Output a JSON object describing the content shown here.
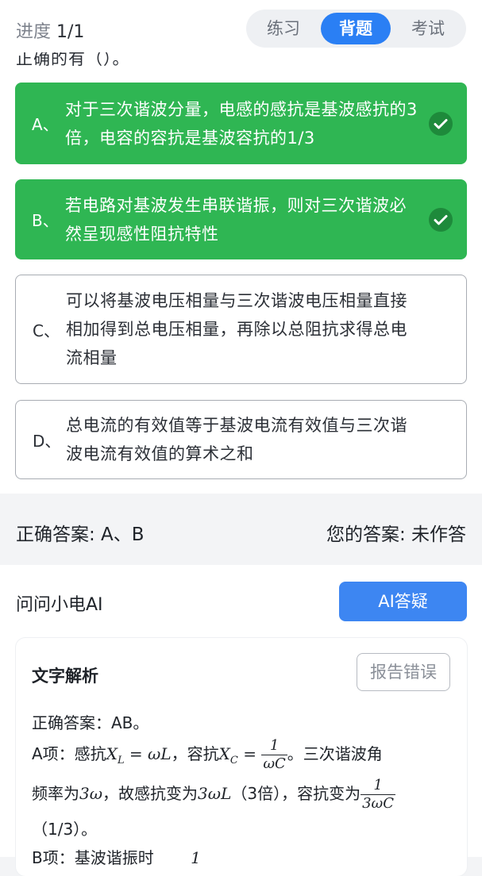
{
  "header": {
    "progress_label": "进度",
    "progress_value": "1/1",
    "tabs": [
      {
        "label": "练习",
        "active": false
      },
      {
        "label": "背题",
        "active": true
      },
      {
        "label": "考试",
        "active": false
      }
    ]
  },
  "question": {
    "partial_stem": "正确的有（）。",
    "options": [
      {
        "letter": "A、",
        "text": "对于三次谐波分量，电感的感抗是基波感抗的3倍，电容的容抗是基波容抗的1/3",
        "correct": true
      },
      {
        "letter": "B、",
        "text": "若电路对基波发生串联谐振，则对三次谐波必然呈现感性阻抗特性",
        "correct": true
      },
      {
        "letter": "C、",
        "text": "可以将基波电压相量与三次谐波电压相量直接相加得到总电压相量，再除以总阻抗求得总电流相量",
        "correct": false
      },
      {
        "letter": "D、",
        "text": "总电流的有效值等于基波电流有效值与三次谐波电流有效值的算术之和",
        "correct": false
      }
    ]
  },
  "answers": {
    "correct": "正确答案: A、B",
    "yours": "您的答案: 未作答"
  },
  "ai": {
    "label": "问问小电AI",
    "button": "AI答疑"
  },
  "analysis": {
    "title": "文字解析",
    "report_button": "报告错误",
    "line1": "正确答案：AB。",
    "a_prefix": "A项：感抗",
    "xl": "X",
    "xl_sub": "L",
    "xl_eq": " = ωL",
    "mid": "，容抗",
    "xc": "X",
    "xc_sub": "C",
    "eq": " = ",
    "frac1_num": "1",
    "frac1_den": "ωC",
    "a_tail": "。三次谐波角",
    "l3_a": "频率为",
    "l3_w": "3ω",
    "l3_b": "，故感抗变为",
    "l3_wl": "3ωL",
    "l3_c": "（3倍），容抗变为",
    "frac2_num": "1",
    "frac2_den": "3ωC",
    "l4": "（1/3）。",
    "l5_cut": "B项：基波谐振时",
    "l5_num": "1"
  },
  "colors": {
    "accent": "#2a7ff4",
    "correct": "#2fb653",
    "check_bg": "#1e8a3b"
  }
}
